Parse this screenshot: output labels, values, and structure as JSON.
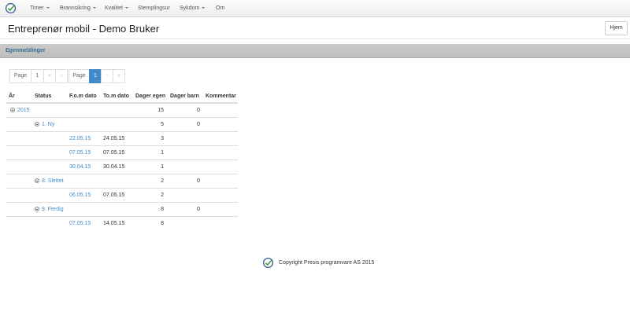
{
  "nav": {
    "items": [
      {
        "label": "Timer",
        "dropdown": true
      },
      {
        "label": "Brannsikring",
        "dropdown": true
      },
      {
        "label": "Kvalitet",
        "dropdown": true
      },
      {
        "label": "Stemplingsur",
        "dropdown": false
      },
      {
        "label": "Sykdom",
        "dropdown": true
      },
      {
        "label": "Om",
        "dropdown": false
      }
    ]
  },
  "header": {
    "title": "Entreprenør mobil - Demo Bruker",
    "home_button": "Hjem"
  },
  "section": {
    "title": "Egenmeldinger"
  },
  "pager": {
    "left": [
      "Page",
      "1",
      "«",
      "‹"
    ],
    "right_label": "Page",
    "current": "1",
    "right": [
      "›",
      "»"
    ]
  },
  "table": {
    "columns": [
      "År",
      "Status",
      "F.o.m dato",
      "To.m dato",
      "Dager egen",
      "Dager barn",
      "Kommentar"
    ],
    "rows": [
      {
        "level": "year",
        "label": "2015",
        "fom": "",
        "tom": "",
        "egen": "15",
        "barn": "0"
      },
      {
        "level": "status",
        "label": "1. Ny",
        "fom": "",
        "tom": "",
        "egen": "5",
        "barn": "0"
      },
      {
        "level": "item",
        "label": "",
        "fom": "22.05.15",
        "tom": "24.05.15",
        "egen": "3",
        "barn": ""
      },
      {
        "level": "item",
        "label": "",
        "fom": "07.05.15",
        "tom": "07.05.15",
        "egen": "1",
        "barn": ""
      },
      {
        "level": "item",
        "label": "",
        "fom": "30.04.15",
        "tom": "30.04.15",
        "egen": "1",
        "barn": ""
      },
      {
        "level": "status",
        "label": "8. Slettet",
        "fom": "",
        "tom": "",
        "egen": "2",
        "barn": "0"
      },
      {
        "level": "item",
        "label": "",
        "fom": "06.05.15",
        "tom": "07.05.15",
        "egen": "2",
        "barn": ""
      },
      {
        "level": "status",
        "label": "9. Ferdig",
        "fom": "",
        "tom": "",
        "egen": "8",
        "barn": "0"
      },
      {
        "level": "item",
        "label": "",
        "fom": "07.05.15",
        "tom": "14.05.15",
        "egen": "8",
        "barn": ""
      }
    ]
  },
  "footer": {
    "text": "Copyright Presis programvare AS 2015"
  },
  "colors": {
    "accent": "#428bca",
    "section_title": "#31708f",
    "section_bar": "#c4c4c4",
    "logo_check": "#3a9a3a"
  }
}
